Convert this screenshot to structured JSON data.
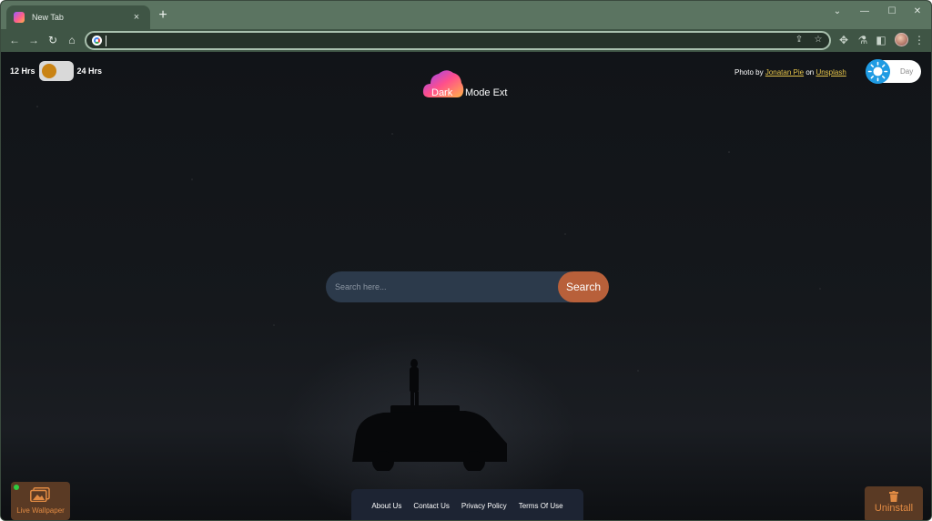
{
  "browser": {
    "tab": {
      "title": "New Tab",
      "close_glyph": "×"
    },
    "new_tab_glyph": "+",
    "window_controls": {
      "dropdown": "⌄",
      "minimize": "—",
      "maximize": "☐",
      "close": "✕"
    },
    "toolbar": {
      "back": "←",
      "forward": "→",
      "reload": "↻",
      "home": "⌂"
    },
    "omnibox": {
      "value": "",
      "placeholder": ""
    },
    "omnibox_icons": {
      "share": "⇪",
      "bookmark": "☆"
    },
    "toolbar_icons": {
      "extensions": "✥",
      "labs": "⚗",
      "sidepanel": "◧",
      "menu": "⋮"
    }
  },
  "clock": {
    "left_label": "12 Hrs",
    "right_label": "24 Hrs",
    "knob_color": "#c98314"
  },
  "logo": {
    "word1": "Dark",
    "word2": "Mode Ext"
  },
  "credit": {
    "prefix": "Photo by",
    "author": "Jonatan Pie",
    "middle": "on",
    "source": "Unsplash"
  },
  "theme_toggle": {
    "label": "Day",
    "sun_color": "#1f9be3"
  },
  "search": {
    "placeholder": "Search here...",
    "value": "",
    "button_label": "Search"
  },
  "live_wallpaper": {
    "label": "Live Wallpaper",
    "status_color": "#2ecc40"
  },
  "footer_links": [
    "About Us",
    "Contact Us",
    "Privacy Policy",
    "Terms Of Use"
  ],
  "uninstall": {
    "label": "Uninstall"
  },
  "colors": {
    "accent": "#b8603a",
    "frame": "#5b7461",
    "search_bg": "#2c3a4b",
    "link": "#e6c44a"
  }
}
